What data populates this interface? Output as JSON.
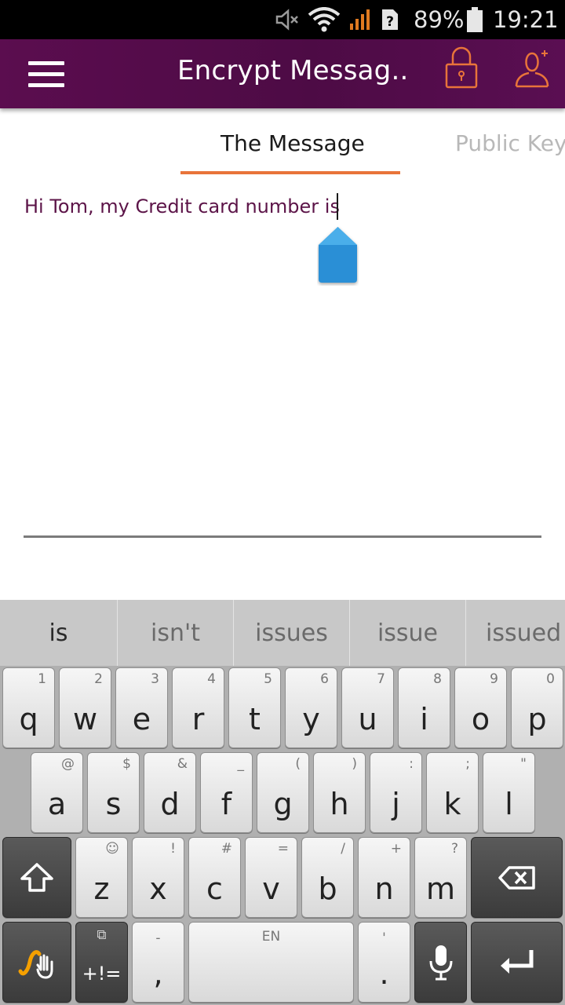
{
  "status_bar": {
    "battery": "89%",
    "time": "19:21"
  },
  "app_bar": {
    "title": "Encrypt Messag.."
  },
  "tabs": [
    {
      "label": "The Message",
      "active": true
    },
    {
      "label": "Public Key",
      "active": false
    }
  ],
  "message": {
    "text": "Hi Tom, my Credit card number is"
  },
  "colors": {
    "app_bar": "#4d0b45",
    "accent": "#e8743a",
    "message_text": "#5c1448",
    "handle": "#2b8fd6"
  },
  "keyboard": {
    "suggestions": [
      "is",
      "isn't",
      "issues",
      "issue",
      "issued"
    ],
    "row1": [
      {
        "key": "q",
        "hint": "1"
      },
      {
        "key": "w",
        "hint": "2"
      },
      {
        "key": "e",
        "hint": "3"
      },
      {
        "key": "r",
        "hint": "4"
      },
      {
        "key": "t",
        "hint": "5"
      },
      {
        "key": "y",
        "hint": "6"
      },
      {
        "key": "u",
        "hint": "7"
      },
      {
        "key": "i",
        "hint": "8"
      },
      {
        "key": "o",
        "hint": "9"
      },
      {
        "key": "p",
        "hint": "0"
      }
    ],
    "row2": [
      {
        "key": "a",
        "hint": "@"
      },
      {
        "key": "s",
        "hint": "$"
      },
      {
        "key": "d",
        "hint": "&"
      },
      {
        "key": "f",
        "hint": "_"
      },
      {
        "key": "g",
        "hint": "("
      },
      {
        "key": "h",
        "hint": ")"
      },
      {
        "key": "j",
        "hint": ":"
      },
      {
        "key": "k",
        "hint": ";"
      },
      {
        "key": "l",
        "hint": "\""
      }
    ],
    "row3": [
      {
        "key": "z",
        "hint": "☺"
      },
      {
        "key": "x",
        "hint": "!"
      },
      {
        "key": "c",
        "hint": "#"
      },
      {
        "key": "v",
        "hint": "="
      },
      {
        "key": "b",
        "hint": "/"
      },
      {
        "key": "n",
        "hint": "+"
      },
      {
        "key": "m",
        "hint": "?"
      }
    ],
    "symbols_label": "+!=",
    "comma_label": ",",
    "comma_hint": "-",
    "space_label": "EN",
    "period_label": ".",
    "period_hint": "'"
  }
}
